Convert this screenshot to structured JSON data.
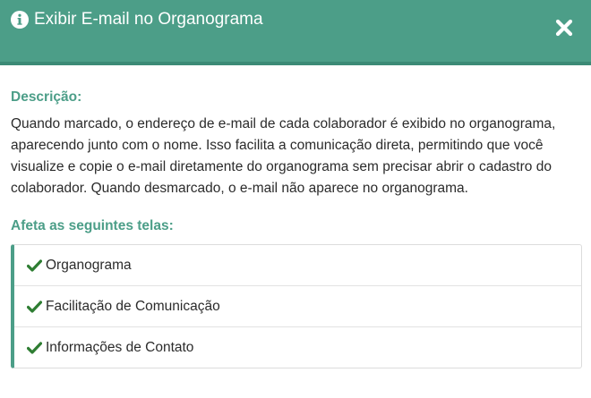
{
  "header": {
    "title": "Exibir E-mail no Organograma",
    "icon": "info-circle-icon",
    "close_icon": "close-icon"
  },
  "description": {
    "label": "Descrição:",
    "text": "Quando marcado, o endereço de e-mail de cada colaborador é exibido no organograma, aparecendo junto com o nome. Isso facilita a comunicação direta, permitindo que você visualize e copie o e-mail diretamente do organograma sem precisar abrir o cadastro do colaborador. Quando desmarcado, o e-mail não aparece no organograma."
  },
  "affected": {
    "label": "Afeta as seguintes telas:",
    "items": [
      {
        "label": "Organograma",
        "icon": "check-icon"
      },
      {
        "label": "Facilitação de Comunicação",
        "icon": "check-icon"
      },
      {
        "label": "Informações de Contato",
        "icon": "check-icon"
      }
    ]
  },
  "colors": {
    "header_bg": "#4c9e88",
    "accent": "#4c9e88",
    "check": "#2e7d32",
    "text": "#2b2b2b"
  }
}
